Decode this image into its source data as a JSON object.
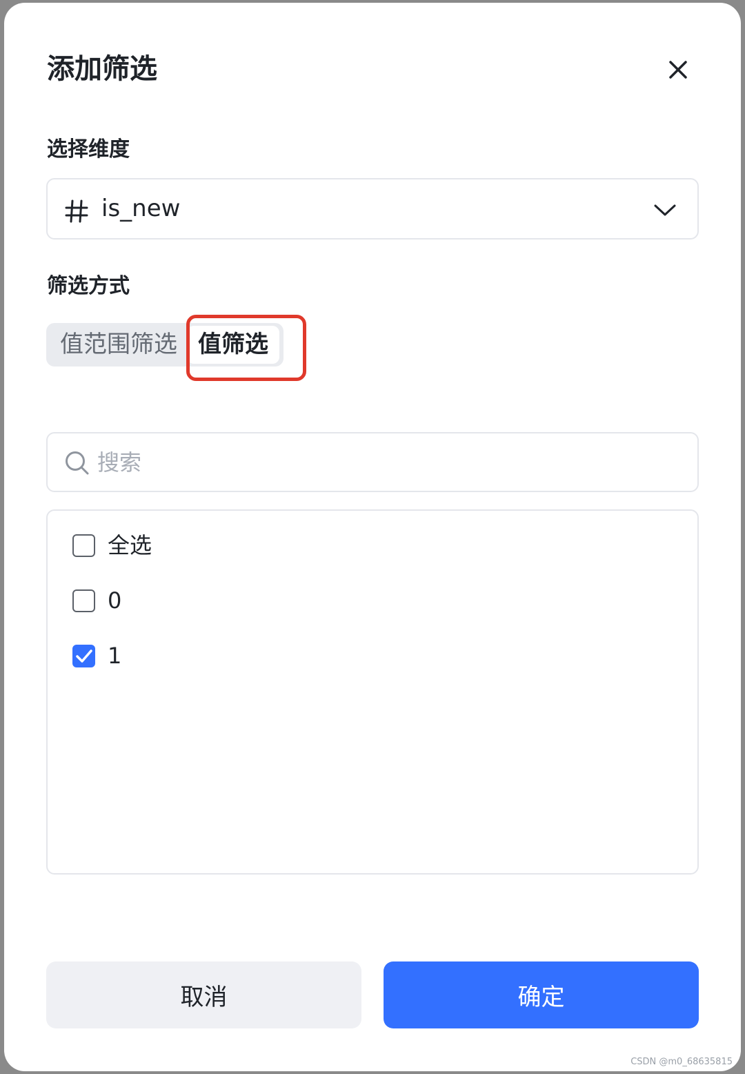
{
  "dialog": {
    "title": "添加筛选",
    "close_icon": "close-icon"
  },
  "dimension": {
    "label": "选择维度",
    "type_icon": "hash-icon",
    "value": "is_new",
    "chevron_icon": "chevron-down-icon"
  },
  "filter_mode": {
    "label": "筛选方式",
    "options": [
      "值范围筛选",
      "值筛选"
    ],
    "selected": "值筛选"
  },
  "search": {
    "icon": "search-icon",
    "placeholder": "搜索",
    "value": ""
  },
  "values_list": {
    "select_all": {
      "label": "全选",
      "checked": false
    },
    "items": [
      {
        "label": "0",
        "checked": false
      },
      {
        "label": "1",
        "checked": true
      }
    ]
  },
  "footer": {
    "cancel_label": "取消",
    "ok_label": "确定"
  },
  "colors": {
    "primary": "#3370ff",
    "highlight": "#e0392b"
  },
  "watermark": "CSDN @m0_68635815"
}
